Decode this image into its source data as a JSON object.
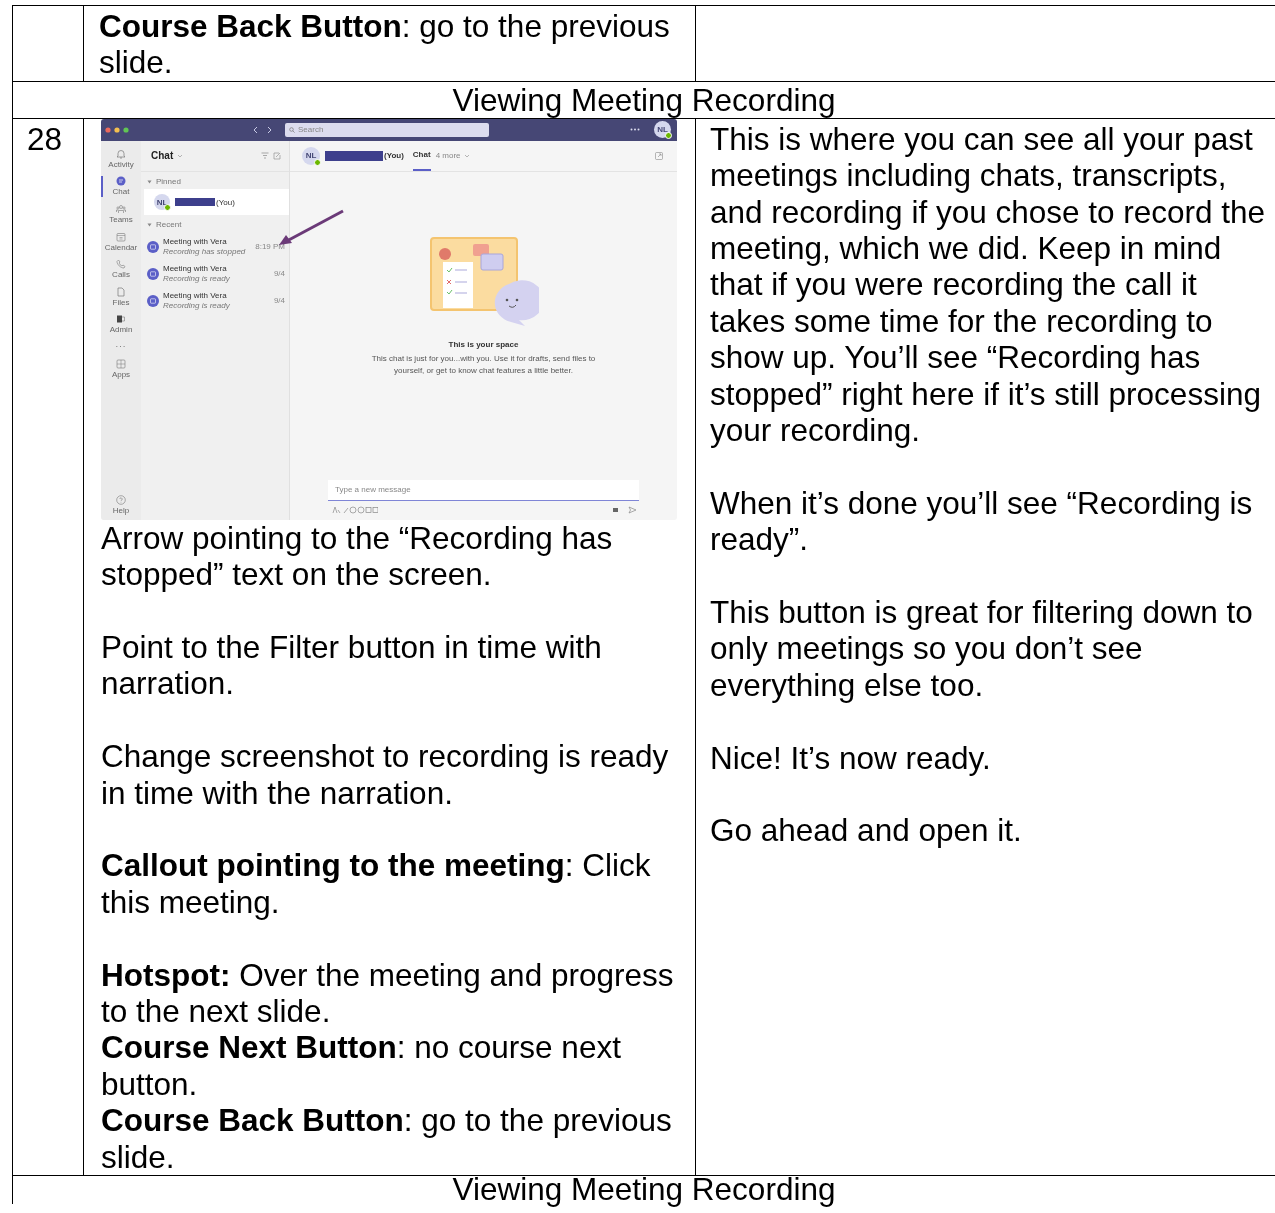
{
  "top_row": {
    "directions": "**Course Back Button**: go to the previous slide."
  },
  "section_header": "Viewing Meeting Recording",
  "row": {
    "number": "28",
    "screenshot": {
      "search_placeholder": "Search",
      "profile_initials": "NL",
      "rail": [
        {
          "label": "Activity",
          "kind": "bell",
          "selected": false
        },
        {
          "label": "Chat",
          "kind": "chat",
          "selected": true
        },
        {
          "label": "Teams",
          "kind": "teams",
          "selected": false
        },
        {
          "label": "Calendar",
          "kind": "calendar",
          "selected": false
        },
        {
          "label": "Calls",
          "kind": "phone",
          "selected": false
        },
        {
          "label": "Files",
          "kind": "file",
          "selected": false
        },
        {
          "label": "Admin",
          "kind": "admin",
          "selected": false
        },
        {
          "label": "···",
          "kind": "more",
          "selected": false
        },
        {
          "label": "Apps",
          "kind": "apps",
          "selected": false
        }
      ],
      "help_label": "Help",
      "chat_title": "Chat",
      "pinned_label": "Pinned",
      "recent_label": "Recent",
      "pinned": {
        "initials": "NL",
        "suffix": "(You)",
        "selected": true
      },
      "chats": [
        {
          "title": "Meeting with Vera",
          "subtitle": "Recording has stopped",
          "time": "8:19 PM",
          "selected": false
        },
        {
          "title": "Meeting with Vera",
          "subtitle": "Recording is ready",
          "time": "9/4",
          "selected": false
        },
        {
          "title": "Meeting with Vera",
          "subtitle": "Recording is ready",
          "time": "9/4",
          "selected": false
        }
      ],
      "header": {
        "initials": "NL",
        "suffix": "(You)",
        "tabs": [
          {
            "label": "Chat",
            "selected": true
          },
          {
            "label": "4 more",
            "selected": false
          }
        ]
      },
      "empty_title": "This is your space",
      "empty_text": "This chat is just for you...with you. Use it for drafts, send files to yourself, or get to know chat features a little better.",
      "composer_placeholder": "Type a new message"
    },
    "directions": [
      [
        "Arrow pointing to the “Recording has stopped” text on the screen."
      ],
      [
        "Point to the Filter button in time with narration."
      ],
      [
        "Change screenshot to recording is ready in time with the narration."
      ],
      [
        "**Callout pointing to the meeting**: Click this meeting."
      ],
      [
        "**Hotspot:** Over the meeting and progress to the next slide.",
        "**Course Next Button**: no course next button.",
        "**Course Back Button**: go to the previous slide."
      ]
    ],
    "narration": [
      [
        "This is where you can see all your past meetings including chats, transcripts, and recording if you chose to record the meeting, which we did. Keep in mind that if you were recording the call it takes some time for the recording to show up. You’ll see “Recording has stopped” right here if it’s still processing your recording."
      ],
      [
        "When it’s done you’ll see “Recording is ready”."
      ],
      [
        "This button is great for filtering down to only meetings so you don’t see everything else too."
      ],
      [
        "Nice! It’s now ready."
      ],
      [
        "Go ahead and open it."
      ]
    ]
  },
  "bottom_section_header": "Viewing Meeting Recording"
}
